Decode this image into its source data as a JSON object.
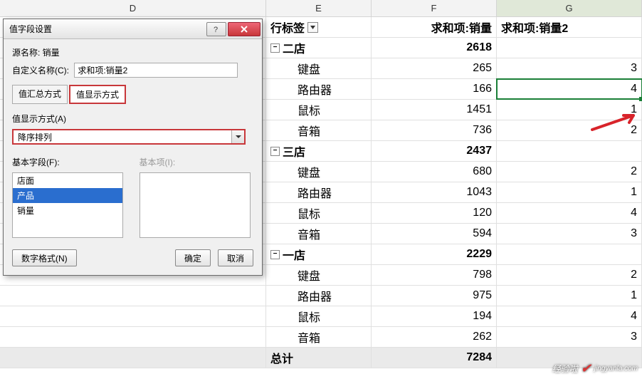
{
  "columns": {
    "D": "D",
    "E": "E",
    "F": "F",
    "G": "G"
  },
  "pivot_header": {
    "rowlabel": "行标签",
    "sum1": "求和项:销量",
    "sum2": "求和项:销量2"
  },
  "groups": [
    {
      "name": "二店",
      "total": "2618",
      "items": [
        {
          "p": "键盘",
          "v": "265",
          "r": "3"
        },
        {
          "p": "路由器",
          "v": "166",
          "r": "4"
        },
        {
          "p": "鼠标",
          "v": "1451",
          "r": "1"
        },
        {
          "p": "音箱",
          "v": "736",
          "r": "2"
        }
      ]
    },
    {
      "name": "三店",
      "total": "2437",
      "items": [
        {
          "p": "键盘",
          "v": "680",
          "r": "2"
        },
        {
          "p": "路由器",
          "v": "1043",
          "r": "1"
        },
        {
          "p": "鼠标",
          "v": "120",
          "r": "4"
        },
        {
          "p": "音箱",
          "v": "594",
          "r": "3"
        }
      ]
    },
    {
      "name": "一店",
      "total": "2229",
      "items": [
        {
          "p": "键盘",
          "v": "798",
          "r": "2"
        },
        {
          "p": "路由器",
          "v": "975",
          "r": "1"
        },
        {
          "p": "鼠标",
          "v": "194",
          "r": "4"
        },
        {
          "p": "音箱",
          "v": "262",
          "r": "3"
        }
      ]
    }
  ],
  "grand": {
    "label": "总计",
    "value": "7284"
  },
  "dialog": {
    "title": "值字段设置",
    "source_label": "源名称:  销量",
    "custom_name_label": "自定义名称(C):",
    "custom_name_value": "求和项:销量2",
    "tab1": "值汇总方式",
    "tab2": "值显示方式",
    "show_label": "值显示方式(A)",
    "show_value": "降序排列",
    "base_field_label": "基本字段(F):",
    "base_item_label": "基本项(I):",
    "fields": [
      "店面",
      "产品",
      "销量"
    ],
    "num_format_btn": "数字格式(N)",
    "ok": "确定",
    "cancel": "取消"
  },
  "watermark": {
    "text1": "经验啦",
    "text2": "jingyanla.com"
  }
}
